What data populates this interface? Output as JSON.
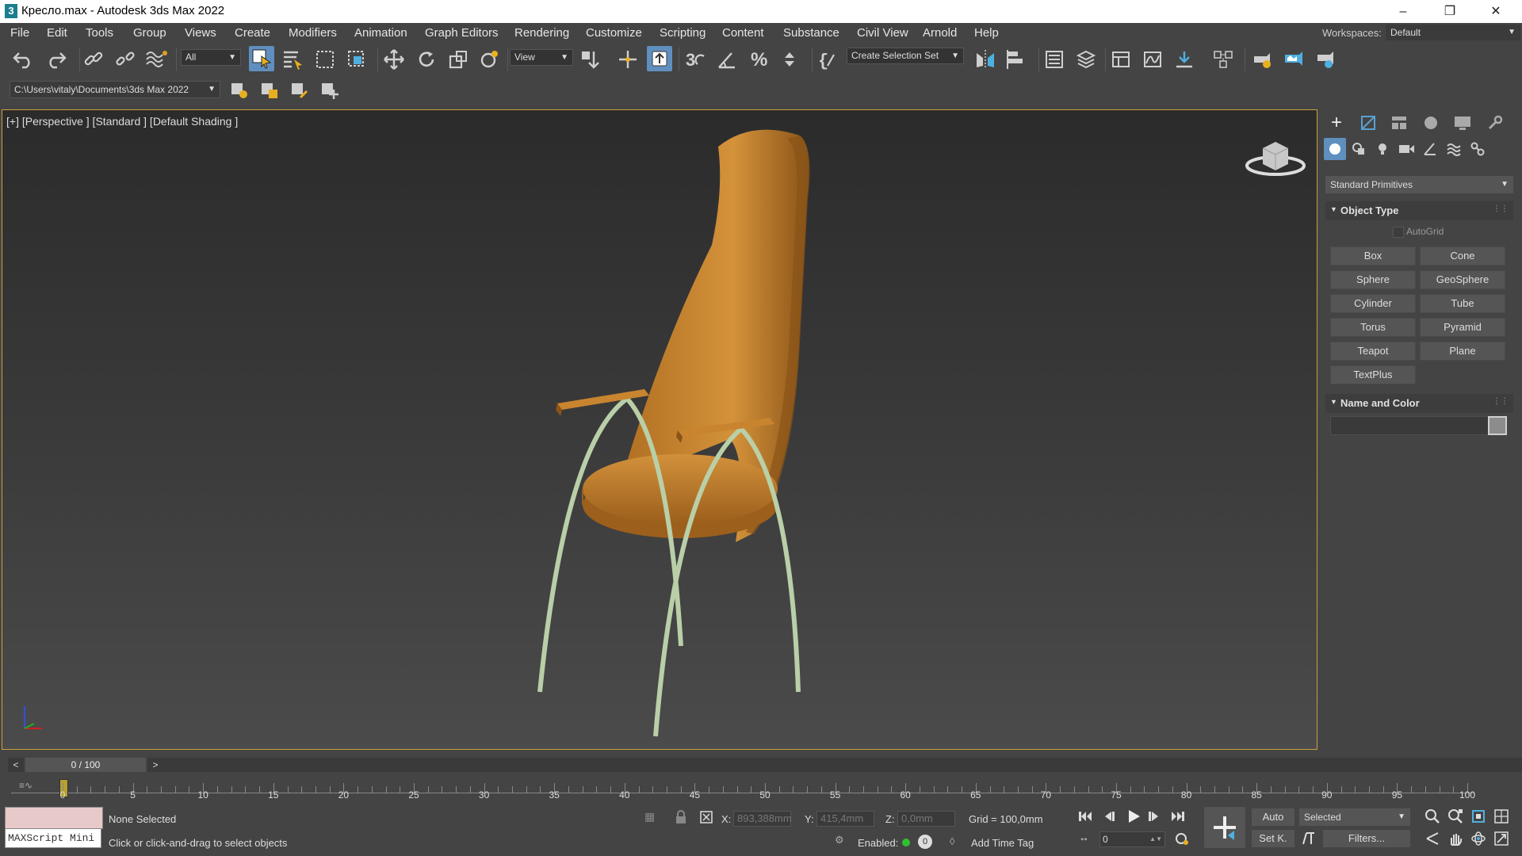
{
  "window": {
    "title": "Кресло.max - Autodesk 3ds Max 2022",
    "app_icon": "3",
    "controls": [
      "minimize-icon",
      "restore-icon",
      "close-icon"
    ]
  },
  "menu": {
    "items": [
      "File",
      "Edit",
      "Tools",
      "Group",
      "Views",
      "Create",
      "Modifiers",
      "Animation",
      "Graph Editors",
      "Rendering",
      "Customize",
      "Scripting",
      "Content",
      "Substance",
      "Civil View",
      "Arnold",
      "Help"
    ],
    "workspaces_label": "Workspaces:",
    "workspace_value": "Default"
  },
  "toolbar": {
    "selection_filter": "All",
    "reference_coord": "View",
    "selection_set": "Create Selection Set",
    "project_path": "C:\\Users\\vitaly\\Documents\\3ds Max 2022"
  },
  "viewport": {
    "label": "[+] [Perspective ] [Standard ] [Default Shading ]",
    "chair_color": "#c8842e",
    "legs_color": "#b9cfa8",
    "border_color": "#c9a13a"
  },
  "command_panel": {
    "category_dropdown": "Standard Primitives",
    "object_type_title": "Object Type",
    "autogrid_label": "AutoGrid",
    "buttons": [
      "Box",
      "Cone",
      "Sphere",
      "GeoSphere",
      "Cylinder",
      "Tube",
      "Torus",
      "Pyramid",
      "Teapot",
      "Plane",
      "TextPlus"
    ],
    "name_color_title": "Name and Color",
    "name_value": ""
  },
  "timeline": {
    "frame_display": "0 / 100",
    "prev_label": "<",
    "next_label": ">",
    "ticks": [
      "0",
      "5",
      "10",
      "15",
      "20",
      "25",
      "30",
      "35",
      "40",
      "45",
      "50",
      "55",
      "60",
      "65",
      "70",
      "75",
      "80",
      "85",
      "90",
      "95",
      "100"
    ]
  },
  "status": {
    "maxscript_label": "MAXScript Mini",
    "selection": "None Selected",
    "prompt": "Click or click-and-drag to select objects",
    "x_label": "X:",
    "x_value": "893,388mm",
    "y_label": "Y:",
    "y_value": "415,4mm",
    "z_label": "Z:",
    "z_value": "0,0mm",
    "grid": "Grid = 100,0mm",
    "enabled_label": "Enabled:",
    "add_time_tag": "Add Time Tag",
    "auto_label": "Auto",
    "setkey_label": "Set K.",
    "key_filter": "Selected",
    "filters_label": "Filters...",
    "frame_value": "0"
  }
}
